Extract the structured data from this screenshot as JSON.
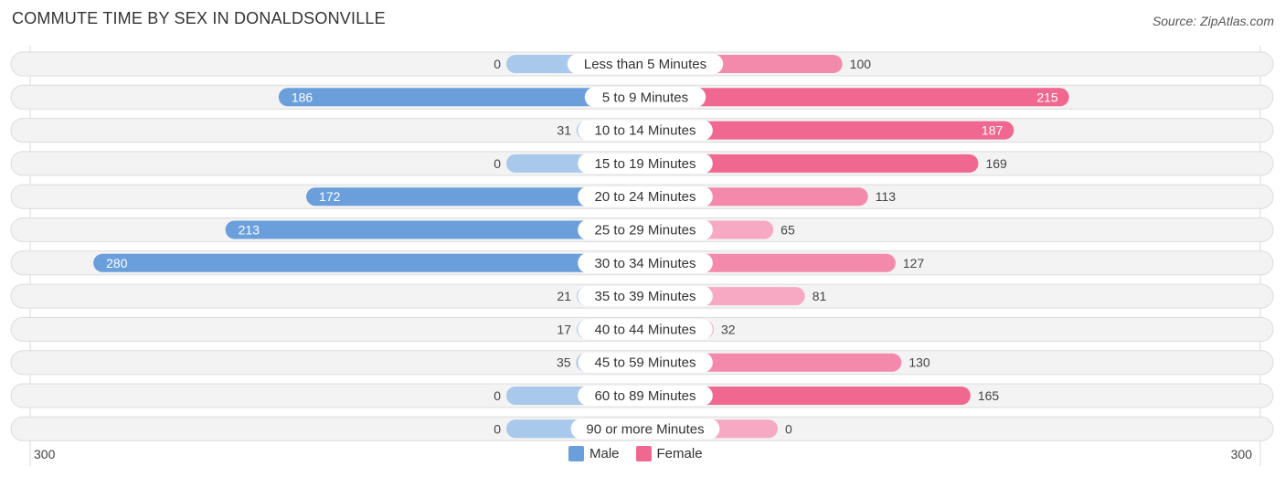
{
  "header": {
    "title": "COMMUTE TIME BY SEX IN DONALDSONVILLE",
    "source": "Source: ZipAtlas.com"
  },
  "colors": {
    "male": "#6a9fdc",
    "male_light": "#a8c8ec",
    "female": "#f06890",
    "female_light": "#f7a8c2",
    "track": "#f3f3f3"
  },
  "chart_data": {
    "type": "bar",
    "orientation": "horizontal-diverging",
    "title": "COMMUTE TIME BY SEX IN DONALDSONVILLE",
    "categories": [
      "Less than 5 Minutes",
      "5 to 9 Minutes",
      "10 to 14 Minutes",
      "15 to 19 Minutes",
      "20 to 24 Minutes",
      "25 to 29 Minutes",
      "30 to 34 Minutes",
      "35 to 39 Minutes",
      "40 to 44 Minutes",
      "45 to 59 Minutes",
      "60 to 89 Minutes",
      "90 or more Minutes"
    ],
    "series": [
      {
        "name": "Male",
        "values": [
          0,
          186,
          31,
          0,
          172,
          213,
          280,
          21,
          17,
          35,
          0,
          0
        ]
      },
      {
        "name": "Female",
        "values": [
          100,
          215,
          187,
          169,
          113,
          65,
          127,
          81,
          32,
          130,
          165,
          0
        ]
      }
    ],
    "axis_min_label": "300",
    "axis_max_label": "300",
    "xlim": [
      -300,
      300
    ],
    "legend": [
      "Male",
      "Female"
    ],
    "legend_position": "bottom-center"
  }
}
